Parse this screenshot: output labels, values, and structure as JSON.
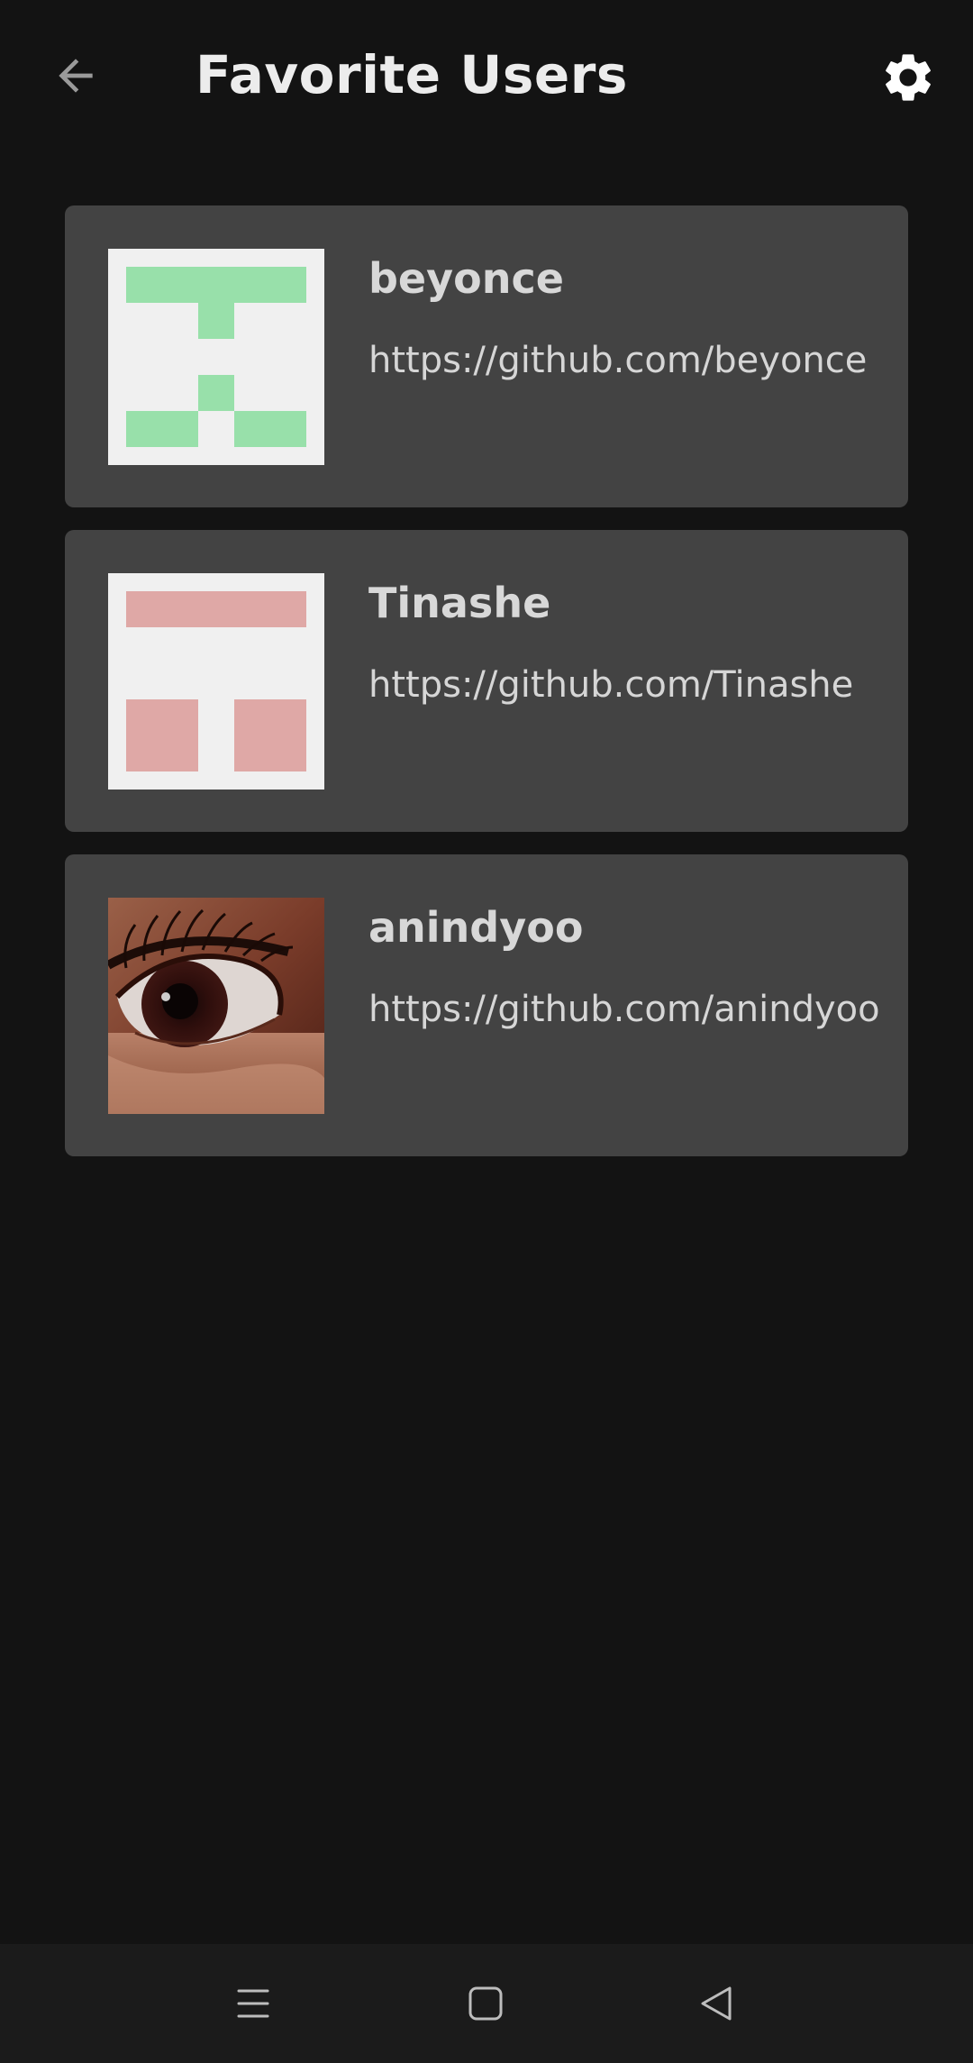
{
  "header": {
    "title": "Favorite Users",
    "back_icon": "arrow-back-icon",
    "settings_icon": "gear-icon"
  },
  "users": [
    {
      "name": "beyonce",
      "url": "https://github.com/beyonce",
      "avatar": "identicon-green",
      "avatar_color": "#98e0aa"
    },
    {
      "name": "Tinashe",
      "url": "https://github.com/Tinashe",
      "avatar": "identicon-pink",
      "avatar_color": "#dfa8a6"
    },
    {
      "name": "anindyoo",
      "url": "https://github.com/anindyoo",
      "avatar": "eye-photo"
    }
  ],
  "nav_bar": {
    "items": [
      "menu-icon",
      "home-icon",
      "back-triangle-icon"
    ]
  },
  "colors": {
    "background": "#131313",
    "card": "#434343",
    "nav_bar": "#1b1b1b",
    "title_text": "#ececec"
  }
}
